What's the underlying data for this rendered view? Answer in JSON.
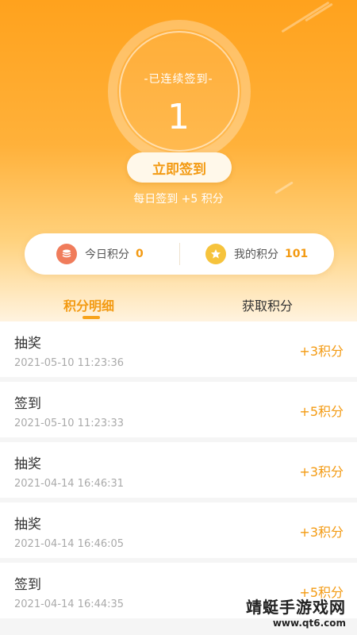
{
  "checkin": {
    "streak_label": "-已连续签到-",
    "streak_days": "1",
    "button_label": "立即签到",
    "daily_note": "每日签到 +5 积分"
  },
  "summary": {
    "today_label": "今日积分",
    "today_value": "0",
    "mine_label": "我的积分",
    "mine_value": "101"
  },
  "tabs": [
    {
      "label": "积分明细",
      "active": true
    },
    {
      "label": "获取积分",
      "active": false
    }
  ],
  "records": [
    {
      "title": "抽奖",
      "time": "2021-05-10 11:23:36",
      "points": "+3积分"
    },
    {
      "title": "签到",
      "time": "2021-05-10 11:23:33",
      "points": "+5积分"
    },
    {
      "title": "抽奖",
      "time": "2021-04-14 16:46:31",
      "points": "+3积分"
    },
    {
      "title": "抽奖",
      "time": "2021-04-14 16:46:05",
      "points": "+3积分"
    },
    {
      "title": "签到",
      "time": "2021-04-14 16:44:35",
      "points": "+5积分"
    }
  ],
  "watermark": {
    "text": "靖蜓手游戏网",
    "url": "www.qt6.com"
  },
  "colors": {
    "accent": "#f39a12",
    "hero_top": "#ffa21d",
    "coin_icon": "#f07c5b",
    "star_icon": "#f6c33c"
  },
  "icons": {
    "today": "coin-stack-icon",
    "mine": "star-icon"
  }
}
